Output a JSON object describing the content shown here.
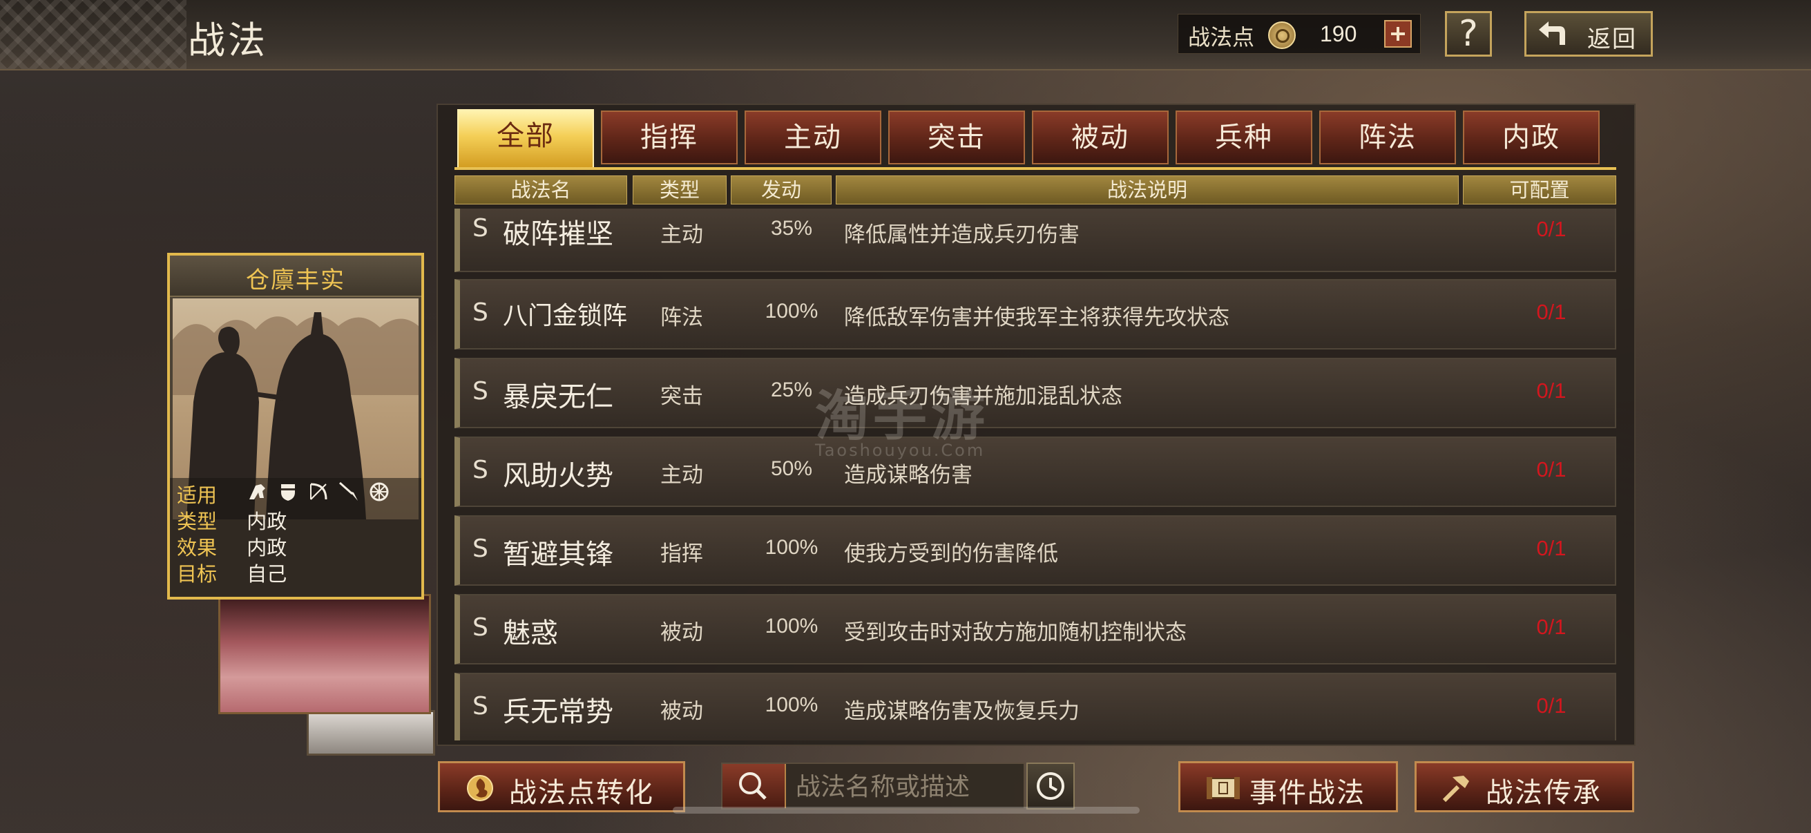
{
  "header": {
    "title": "战法",
    "points_label": "战法点",
    "points_value": "190",
    "help_label": "?",
    "back_label": "返回"
  },
  "card": {
    "title": "仓廪丰实",
    "rows": [
      {
        "key": "适用",
        "value": ""
      },
      {
        "key": "类型",
        "value": "内政"
      },
      {
        "key": "效果",
        "value": "内政"
      },
      {
        "key": "目标",
        "value": "自己"
      }
    ],
    "unit_icons": [
      "cavalry-icon",
      "shield-icon",
      "bow-icon",
      "spear-icon",
      "wheel-icon"
    ]
  },
  "tabs": [
    "全部",
    "指挥",
    "主动",
    "突击",
    "被动",
    "兵种",
    "阵法",
    "内政"
  ],
  "active_tab": "全部",
  "columns": [
    "战法名",
    "类型",
    "发动",
    "战法说明",
    "可配置"
  ],
  "rows": [
    {
      "grade": "S",
      "name": "破阵摧坚",
      "type": "主动",
      "rate": "35%",
      "desc": "降低属性并造成兵刃伤害",
      "config": "0/1"
    },
    {
      "grade": "S",
      "name": "八门金锁阵",
      "type": "阵法",
      "rate": "100%",
      "desc": "降低敌军伤害并使我军主将获得先攻状态",
      "config": "0/1"
    },
    {
      "grade": "S",
      "name": "暴戾无仁",
      "type": "突击",
      "rate": "25%",
      "desc": "造成兵刃伤害并施加混乱状态",
      "config": "0/1"
    },
    {
      "grade": "S",
      "name": "风助火势",
      "type": "主动",
      "rate": "50%",
      "desc": "造成谋略伤害",
      "config": "0/1"
    },
    {
      "grade": "S",
      "name": "暂避其锋",
      "type": "指挥",
      "rate": "100%",
      "desc": "使我方受到的伤害降低",
      "config": "0/1"
    },
    {
      "grade": "S",
      "name": "魅惑",
      "type": "被动",
      "rate": "100%",
      "desc": "受到攻击时对敌方施加随机控制状态",
      "config": "0/1"
    },
    {
      "grade": "S",
      "name": "兵无常势",
      "type": "被动",
      "rate": "100%",
      "desc": "造成谋略伤害及恢复兵力",
      "config": "0/1"
    }
  ],
  "bottom": {
    "convert_label": "战法点转化",
    "search_placeholder": "战法名称或描述",
    "event_label": "事件战法",
    "inherit_label": "战法传承"
  },
  "watermark": {
    "big": "淘手游",
    "small": "Taoshouyou.Com"
  },
  "colors": {
    "accent_gold": "#efc453",
    "tab_red": "#8a3b28",
    "config_red": "#d3161e"
  }
}
